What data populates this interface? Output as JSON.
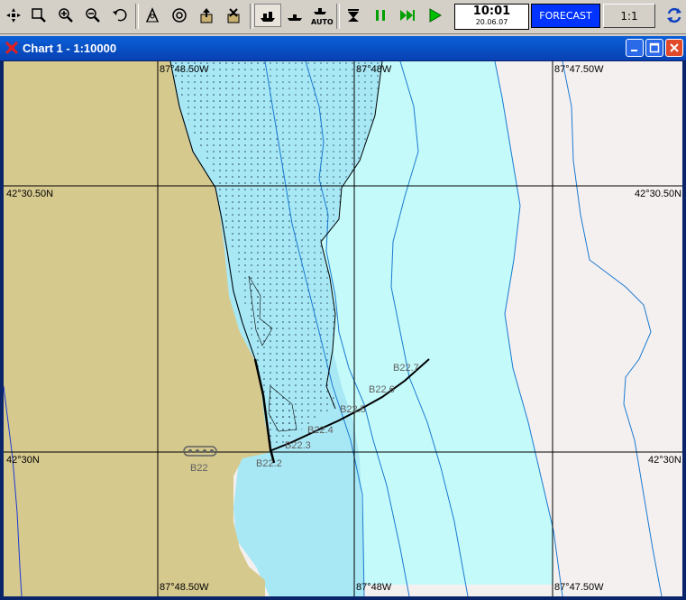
{
  "toolbar": {
    "auto_label": "AUTO",
    "time": "10:01",
    "date": "20.06.07",
    "forecast_label": "FORECAST",
    "scale_button_label": "1:1",
    "icons": [
      "pan-icon",
      "zoom-window-icon",
      "zoom-in-icon",
      "zoom-out-icon",
      "undo-zoom-icon",
      "route-icon",
      "target-icon",
      "export-icon",
      "delete-icon",
      "ship-icon",
      "vessel-icon",
      "auto-icon",
      "step-down-icon",
      "pause-icon",
      "fast-forward-icon",
      "play-icon",
      "sync-icon"
    ]
  },
  "window": {
    "title": "Chart 1 - 1:10000"
  },
  "chart": {
    "longitudes": [
      "87°48.50W",
      "87°48W",
      "87°47.50W"
    ],
    "latitudes": [
      "42°30.50N",
      "42°30N"
    ],
    "buoys": [
      "B22",
      "B22.2",
      "B22.3",
      "B22.4",
      "B22.5",
      "B22.6",
      "B22.7"
    ],
    "colors": {
      "land": "#d6c98e",
      "shallow": "#a8e8f5",
      "water_mid": "#c4fafa",
      "deep": "#f5f0f0",
      "contour": "#1a7ad0",
      "grid": "#000000"
    }
  }
}
